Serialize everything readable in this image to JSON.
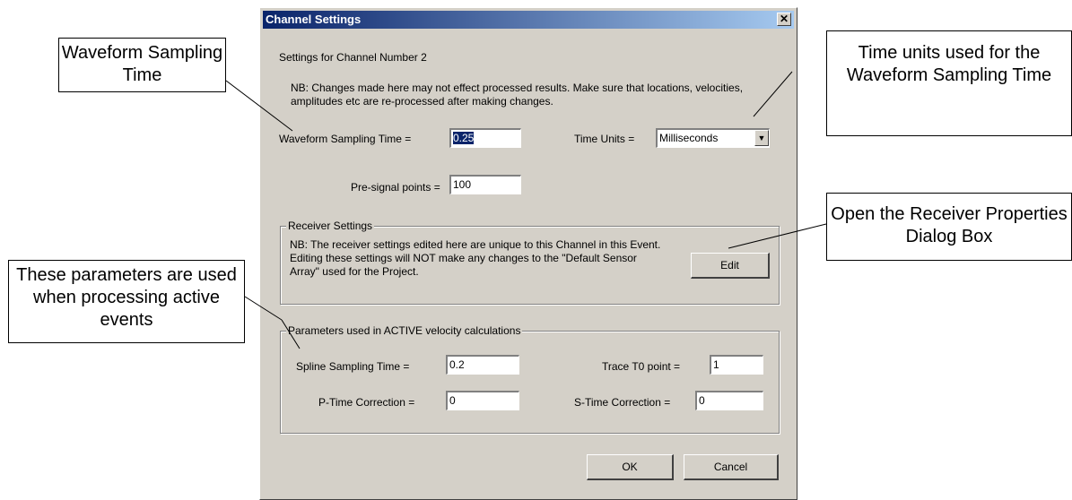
{
  "dialog": {
    "title": "Channel Settings",
    "close_glyph": "✕",
    "heading": "Settings for Channel Number 2",
    "nb_note": "NB: Changes made here may not effect processed results. Make sure that locations, velocities, amplitudes etc are re-processed after making changes.",
    "waveform_label": "Waveform Sampling Time =",
    "waveform_value": "0.25",
    "time_units_label": "Time Units =",
    "time_units_value": "Milliseconds",
    "presignal_label": "Pre-signal points =",
    "presignal_value": "100",
    "receiver": {
      "legend": "Receiver Settings",
      "note": "NB: The receiver settings edited here are unique to this Channel in this Event. Editing these settings will NOT make any changes to the \"Default Sensor Array\" used for the Project.",
      "edit_label": "Edit"
    },
    "active": {
      "legend": "Parameters used in ACTIVE velocity calculations",
      "spline_label": "Spline Sampling Time =",
      "spline_value": "0.2",
      "trace_label": "Trace T0 point =",
      "trace_value": "1",
      "ptime_label": "P-Time Correction =",
      "ptime_value": "0",
      "stime_label": "S-Time Correction =",
      "stime_value": "0"
    },
    "ok_label": "OK",
    "cancel_label": "Cancel"
  },
  "callouts": {
    "waveform": "Waveform Sampling Time",
    "time_units": "Time units used for the Waveform Sampling Time",
    "receiver": "Open the Receiver Properties Dialog Box",
    "parameters": "These parameters are used when processing active events"
  },
  "icons": {
    "dropdown": "chevron-down-icon",
    "close": "close-icon"
  },
  "colors": {
    "titlebar_start": "#0a246a",
    "titlebar_end": "#a6caf0",
    "dialog_bg": "#d4d0c8"
  }
}
